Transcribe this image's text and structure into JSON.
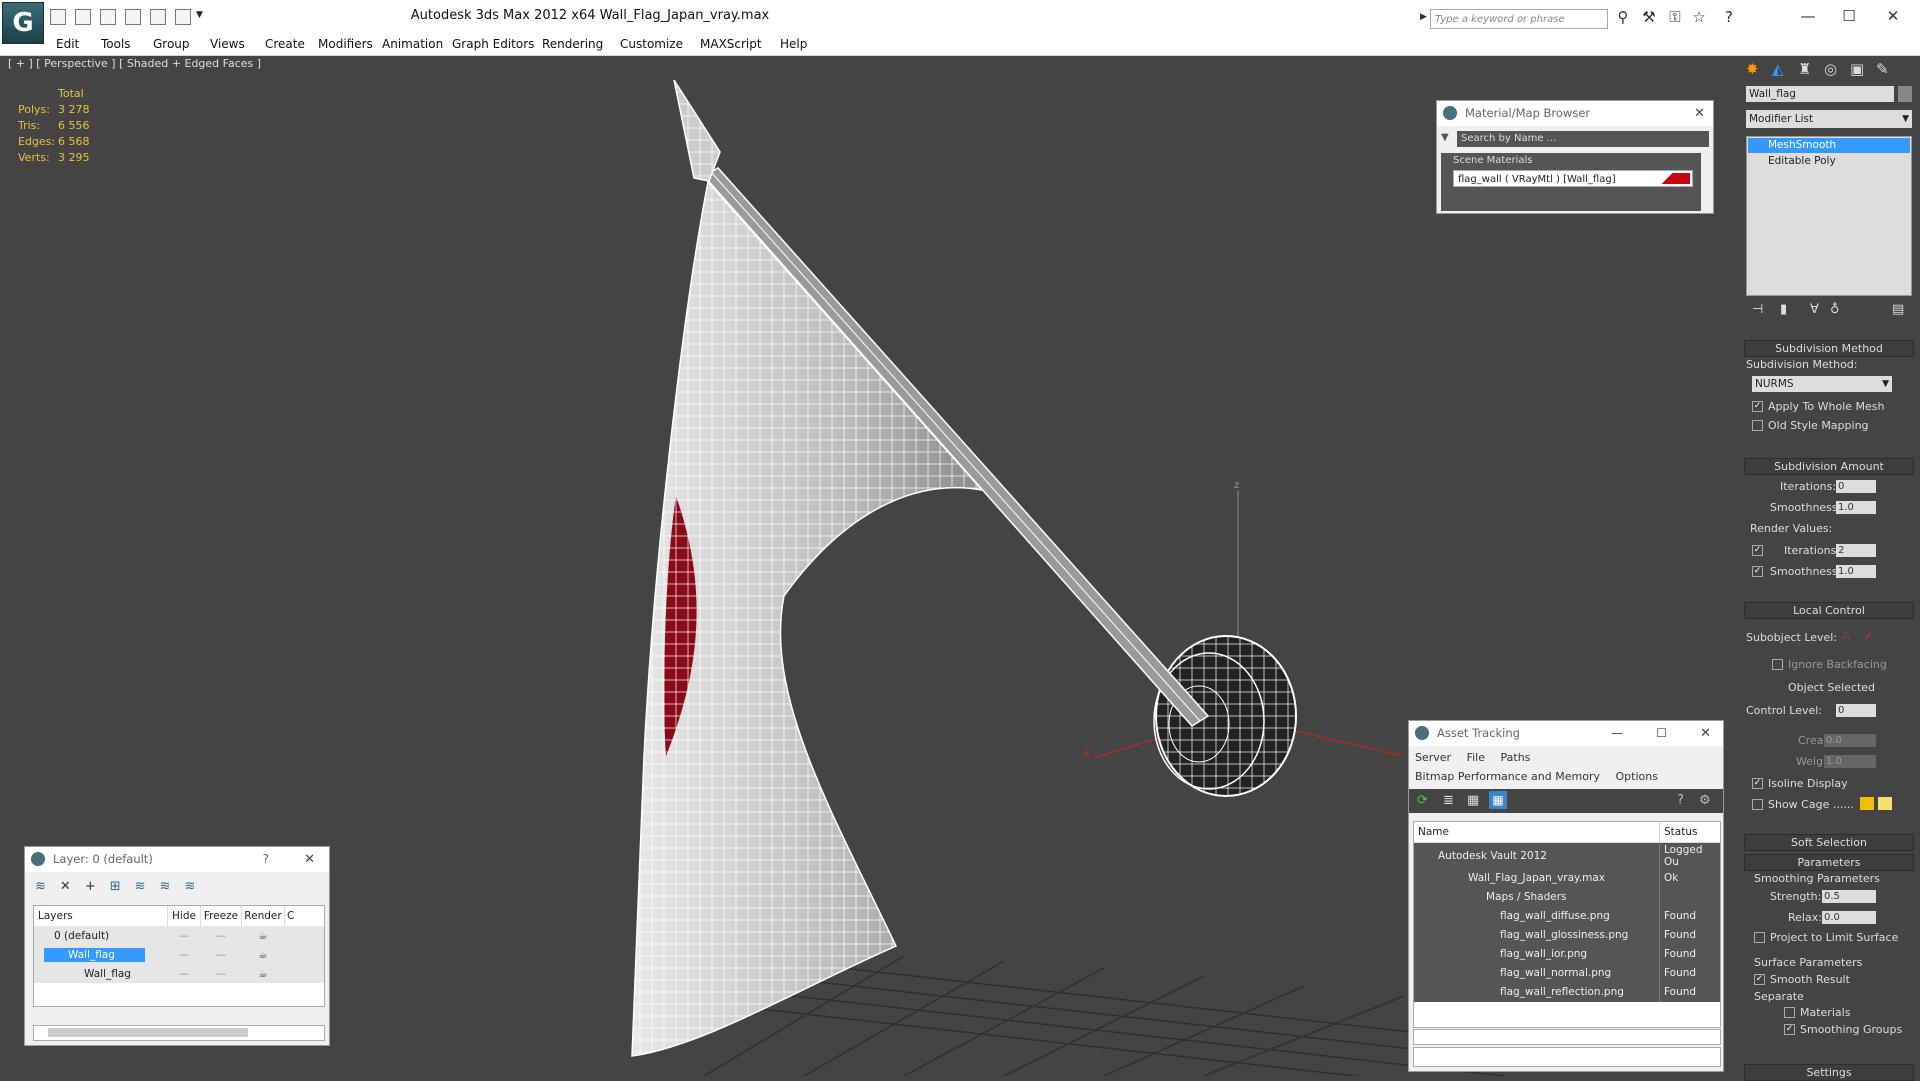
{
  "app": {
    "logo_text": "G",
    "title": "Autodesk 3ds Max  2012 x64      Wall_Flag_Japan_vray.max",
    "search_placeholder": "Type a keyword or phrase",
    "minimize": "—",
    "maximize": "☐",
    "close": "✕"
  },
  "menu": [
    "Edit",
    "Tools",
    "Group",
    "Views",
    "Create",
    "Modifiers",
    "Animation",
    "Graph Editors",
    "Rendering",
    "Customize",
    "MAXScript",
    "Help"
  ],
  "viewport": {
    "label": "[ + ] [ Perspective ] [ Shaded + Edged Faces ]",
    "stats_header": "Total",
    "stats": [
      {
        "label": "Polys:",
        "value": "3 278"
      },
      {
        "label": "Tris:",
        "value": "6 556"
      },
      {
        "label": "Edges:",
        "value": "6 568"
      },
      {
        "label": "Verts:",
        "value": "3 295"
      }
    ],
    "axis_z": "z",
    "axis_x": "x"
  },
  "material_browser": {
    "title": "Material/Map Browser",
    "search_placeholder": "Search by Name ...",
    "group": "Scene Materials",
    "item": "flag_wall  ( VRayMtl ) [Wall_flag]"
  },
  "layer_panel": {
    "title": "Layer: 0 (default)",
    "help": "?",
    "columns": [
      "Layers",
      "Hide",
      "Freeze",
      "Render",
      "C"
    ],
    "rows": [
      {
        "name": "0 (default)",
        "active": "✓"
      },
      {
        "name": "Wall_flag",
        "active": ""
      },
      {
        "name": "Wall_flag",
        "active": ""
      }
    ]
  },
  "asset_tracking": {
    "title": "Asset Tracking",
    "menu": [
      "Server",
      "File",
      "Paths"
    ],
    "menu2": [
      "Bitmap Performance and Memory",
      "Options"
    ],
    "columns": [
      "Name",
      "Status"
    ],
    "rows": [
      {
        "name": "Autodesk Vault 2012",
        "status": "Logged Ou"
      },
      {
        "name": "Wall_Flag_Japan_vray.max",
        "status": "Ok"
      },
      {
        "name": "Maps / Shaders",
        "status": ""
      },
      {
        "name": "flag_wall_diffuse.png",
        "status": "Found"
      },
      {
        "name": "flag_wall_glossiness.png",
        "status": "Found"
      },
      {
        "name": "flag_wall_ior.png",
        "status": "Found"
      },
      {
        "name": "flag_wall_normal.png",
        "status": "Found"
      },
      {
        "name": "flag_wall_reflection.png",
        "status": "Found"
      }
    ]
  },
  "command_panel": {
    "object_name": "Wall_flag",
    "modifier_list": "Modifier List",
    "stack": [
      "MeshSmooth",
      "Editable Poly"
    ],
    "subdivision_method": {
      "title": "Subdivision Method",
      "label": "Subdivision Method:",
      "value": "NURMS",
      "apply_whole_mesh": "Apply To Whole Mesh",
      "old_style_mapping": "Old Style Mapping"
    },
    "subdivision_amount": {
      "title": "Subdivision Amount",
      "iterations_label": "Iterations:",
      "iterations": "0",
      "smoothness_label": "Smoothness:",
      "smoothness": "1.0",
      "render_values": "Render Values:",
      "r_iterations_label": "Iterations:",
      "r_iterations": "2",
      "r_smoothness_label": "Smoothness:",
      "r_smoothness": "1.0"
    },
    "local_control": {
      "title": "Local Control",
      "subobject_level": "Subobject Level:",
      "ignore_backfacing": "Ignore Backfacing",
      "object_selected": "Object Selected",
      "control_level_label": "Control Level:",
      "control_level": "0",
      "crease_label": "Crease:",
      "crease": "0.0",
      "weight_label": "Weight:",
      "weight": "1.0",
      "isoline_display": "Isoline Display",
      "show_cage": "Show Cage ......"
    },
    "soft_selection": "Soft Selection",
    "parameters": {
      "title": "Parameters",
      "smoothing_params": "Smoothing Parameters",
      "strength_label": "Strength:",
      "strength": "0.5",
      "relax_label": "Relax:",
      "relax": "0.0",
      "project_limit": "Project to Limit Surface",
      "surface_params": "Surface Parameters",
      "smooth_result": "Smooth Result",
      "separate": "Separate",
      "materials": "Materials",
      "smoothing_groups": "Smoothing Groups"
    },
    "settings": "Settings"
  },
  "colors": {
    "viewport_bg": "#444444",
    "stats": "#e8c13c",
    "selection": "#3399ff",
    "flag_red": "#8b0a1a"
  }
}
